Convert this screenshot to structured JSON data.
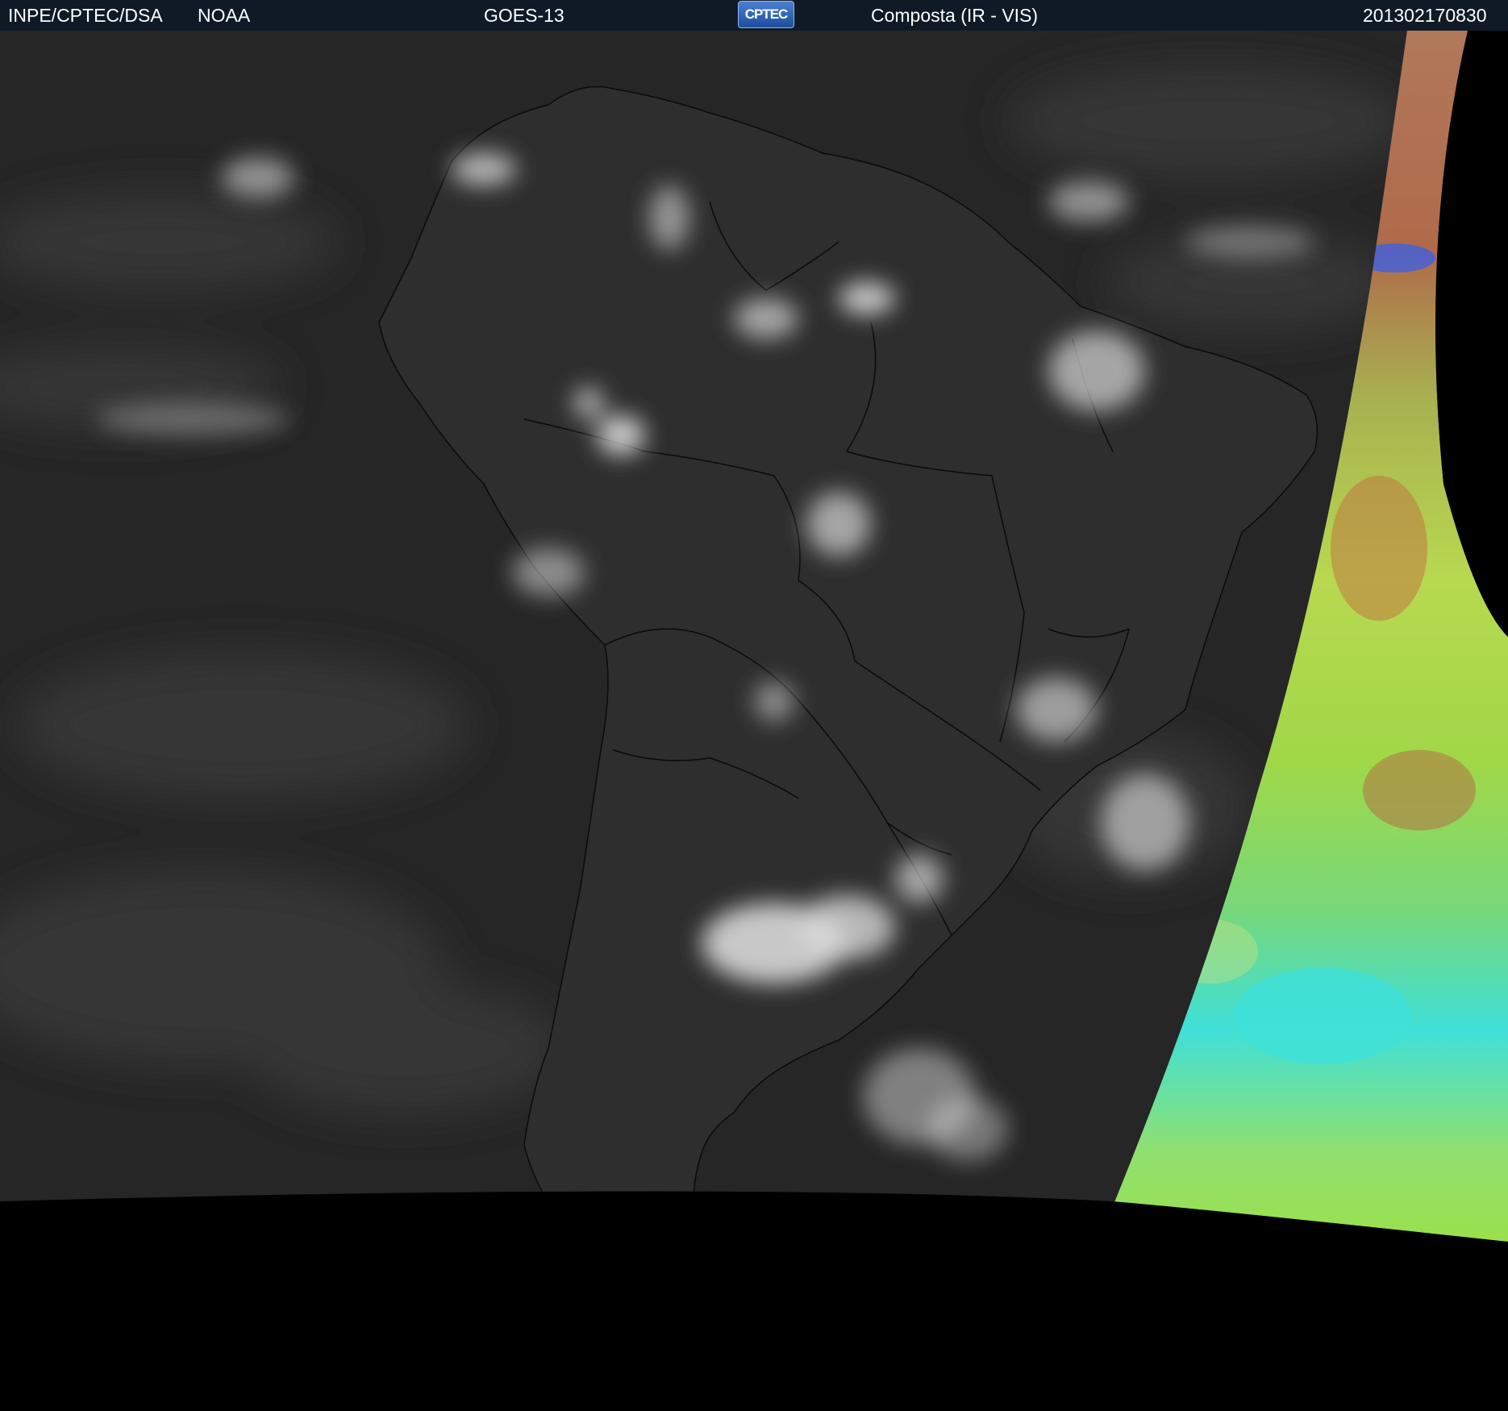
{
  "header": {
    "org": "INPE/CPTEC/DSA",
    "agency": "NOAA",
    "satellite": "GOES-13",
    "logo_text": "CPTEC",
    "product": "Composta (IR - VIS)",
    "timestamp": "201302170830"
  },
  "colors": {
    "header_bg": "#0f1a26",
    "ocean": "#262626",
    "land": "#2e2e2e",
    "cloud": "#d9d9d9",
    "border_line": "#0a0a0a",
    "vis_green": "#9be04a",
    "vis_brown": "#a0784a",
    "vis_cyan": "#3fe0d8",
    "space": "#000000"
  }
}
